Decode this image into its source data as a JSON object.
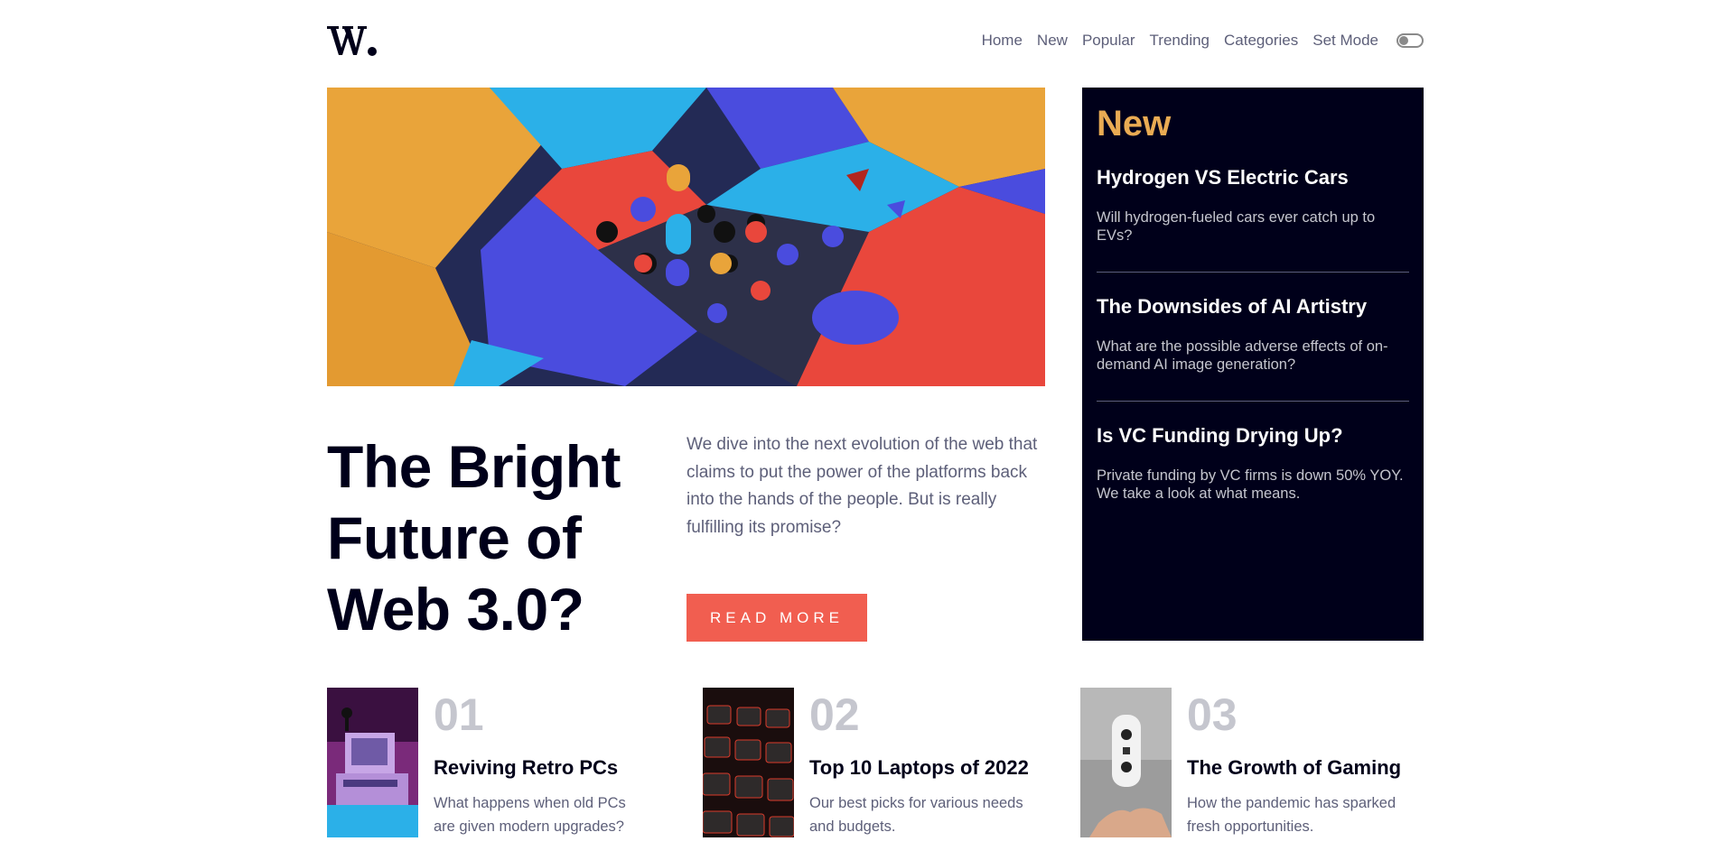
{
  "header": {
    "logo_text": "W.",
    "nav": [
      "Home",
      "New",
      "Popular",
      "Trending",
      "Categories",
      "Set Mode"
    ]
  },
  "hero": {
    "title": "The Bright Future of Web 3.0?",
    "description": "We dive into the next evolution of the web that claims to put the power of the platforms back into the hands of the people. But is really fulfilling its promise?",
    "button_label": "READ MORE"
  },
  "new_section": {
    "heading": "New",
    "items": [
      {
        "title": "Hydrogen VS Electric Cars",
        "desc": "Will hydrogen-fueled cars ever catch up to EVs?"
      },
      {
        "title": "The Downsides of AI Artistry",
        "desc": "What are the possible adverse effects of on-demand AI image generation?"
      },
      {
        "title": "Is VC Funding Drying Up?",
        "desc": "Private funding by VC firms is down 50% YOY. We take a look at what means."
      }
    ]
  },
  "cards": [
    {
      "num": "01",
      "title": "Reviving Retro PCs",
      "desc": "What happens when old PCs are given modern upgrades?"
    },
    {
      "num": "02",
      "title": "Top 10 Laptops of 2022",
      "desc": "Our best picks for various needs and budgets."
    },
    {
      "num": "03",
      "title": "The Growth of Gaming",
      "desc": "How the pandemic has sparked fresh opportunities."
    }
  ],
  "colors": {
    "accent_red": "#f15e50",
    "accent_orange": "#e9ab53",
    "dark_navy": "#00001a",
    "grey_blue": "#5d5f79",
    "light_grey": "#c5c6ce"
  }
}
